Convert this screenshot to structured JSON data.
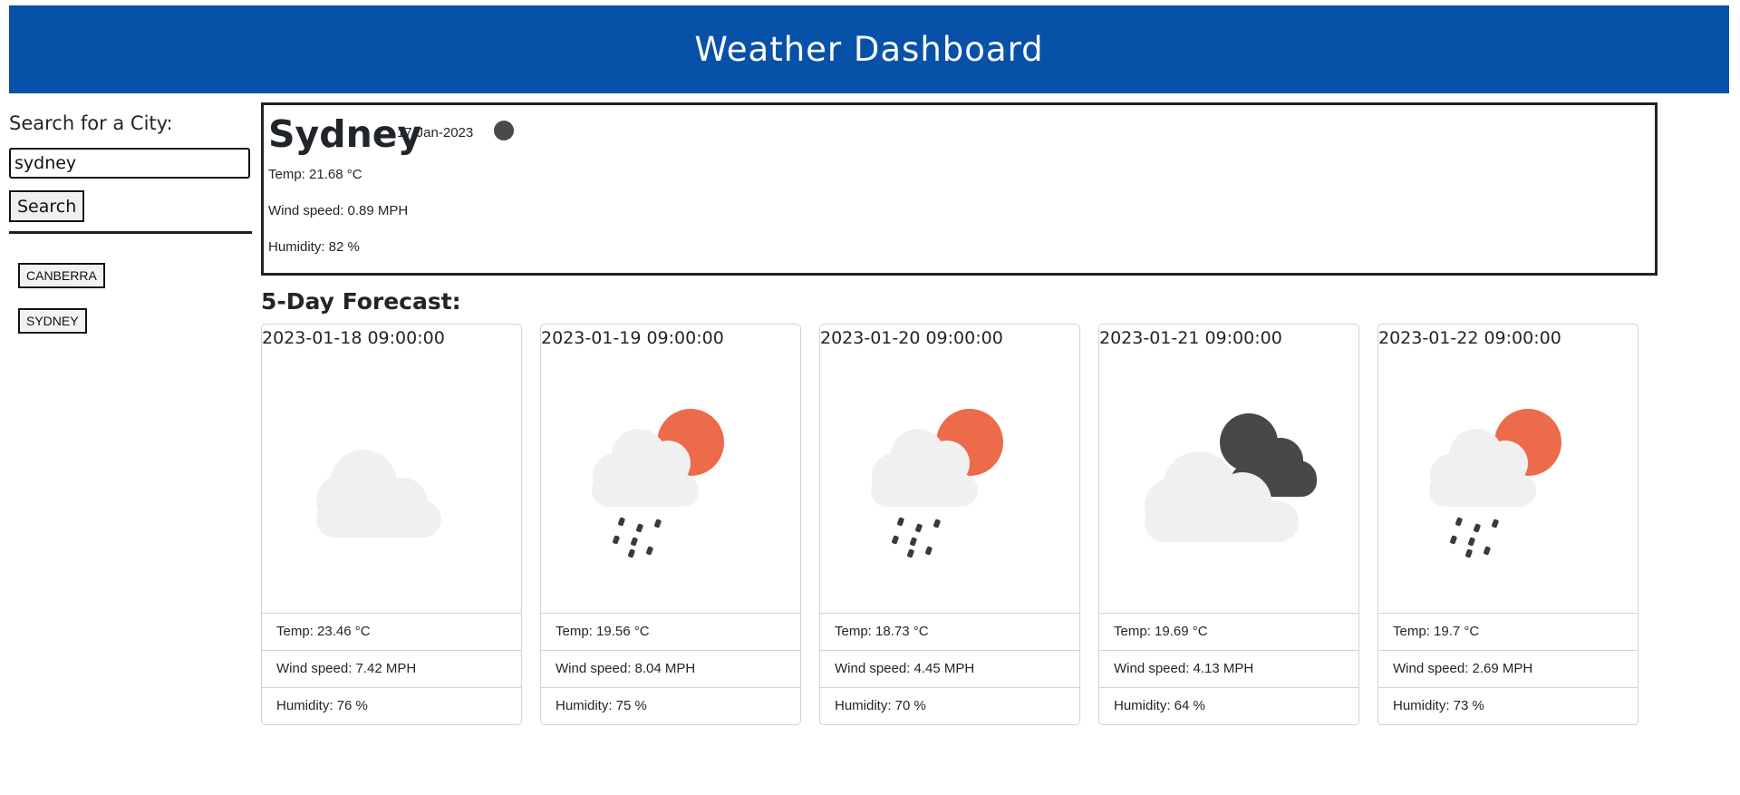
{
  "header": {
    "title": "Weather Dashboard"
  },
  "search": {
    "label": "Search for a City:",
    "value": "sydney",
    "button_label": "Search"
  },
  "history": [
    "CANBERRA",
    "SYDNEY"
  ],
  "current": {
    "city": "Sydney",
    "date": "17-Jan-2023",
    "temp": "Temp: 21.68 °C",
    "wind": "Wind speed: 0.89 MPH",
    "humidity": "Humidity: 82 %"
  },
  "forecast_title": "5-Day Forecast:",
  "forecast": [
    {
      "datetime": "2023-01-18 09:00:00",
      "icon": "cloud-icon",
      "temp": "Temp: 23.46 °C",
      "wind": "Wind speed: 7.42 MPH",
      "humidity": "Humidity: 76 %"
    },
    {
      "datetime": "2023-01-19 09:00:00",
      "icon": "rain-sun-icon",
      "temp": "Temp: 19.56 °C",
      "wind": "Wind speed: 8.04 MPH",
      "humidity": "Humidity: 75 %"
    },
    {
      "datetime": "2023-01-20 09:00:00",
      "icon": "rain-sun-icon",
      "temp": "Temp: 18.73 °C",
      "wind": "Wind speed: 4.45 MPH",
      "humidity": "Humidity: 70 %"
    },
    {
      "datetime": "2023-01-21 09:00:00",
      "icon": "dark-clouds-icon",
      "temp": "Temp: 19.69 °C",
      "wind": "Wind speed: 4.13 MPH",
      "humidity": "Humidity: 64 %"
    },
    {
      "datetime": "2023-01-22 09:00:00",
      "icon": "rain-sun-icon",
      "temp": "Temp: 19.7 °C",
      "wind": "Wind speed: 2.69 MPH",
      "humidity": "Humidity: 73 %"
    }
  ],
  "colors": {
    "header_bg": "#0751a8",
    "sun": "#ec6b4a",
    "cloud": "#f0f0f0",
    "dark_cloud": "#48484a"
  }
}
